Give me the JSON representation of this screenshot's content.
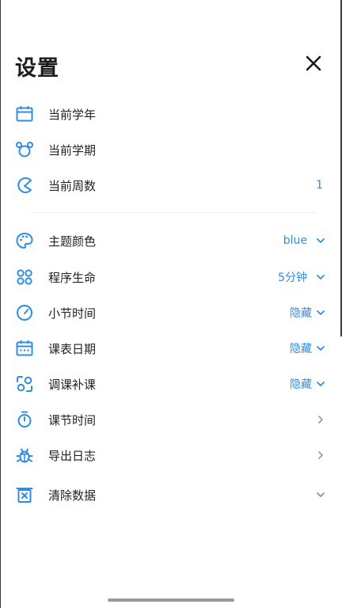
{
  "title": "设置",
  "accent_color": "#2f8de4",
  "rows": [
    {
      "label": "当前学年",
      "value": "",
      "icon": "calendar-icon",
      "chevron": ""
    },
    {
      "label": "当前学期",
      "value": "",
      "icon": "bear-icon",
      "chevron": ""
    },
    {
      "label": "当前周数",
      "value": "1",
      "icon": "pacman-icon",
      "chevron": ""
    },
    {
      "label": "主题颜色",
      "value": "blue",
      "icon": "palette-icon",
      "chevron": "down"
    },
    {
      "label": "程序生命",
      "value": "5分钟",
      "icon": "circles-grid-icon",
      "chevron": "down"
    },
    {
      "label": "小节时间",
      "value": "隐藏",
      "icon": "gauge-icon",
      "chevron": "down"
    },
    {
      "label": "课表日期",
      "value": "隐藏",
      "icon": "calendar-dots-icon",
      "chevron": "down"
    },
    {
      "label": "调课补课",
      "value": "隐藏",
      "icon": "swap-icon",
      "chevron": "down"
    },
    {
      "label": "课节时间",
      "value": "",
      "icon": "stopwatch-icon",
      "chevron": "right"
    },
    {
      "label": "导出日志",
      "value": "",
      "icon": "bug-icon",
      "chevron": "right"
    },
    {
      "label": "清除数据",
      "value": "",
      "icon": "trash-icon",
      "chevron": "down-gray"
    }
  ]
}
